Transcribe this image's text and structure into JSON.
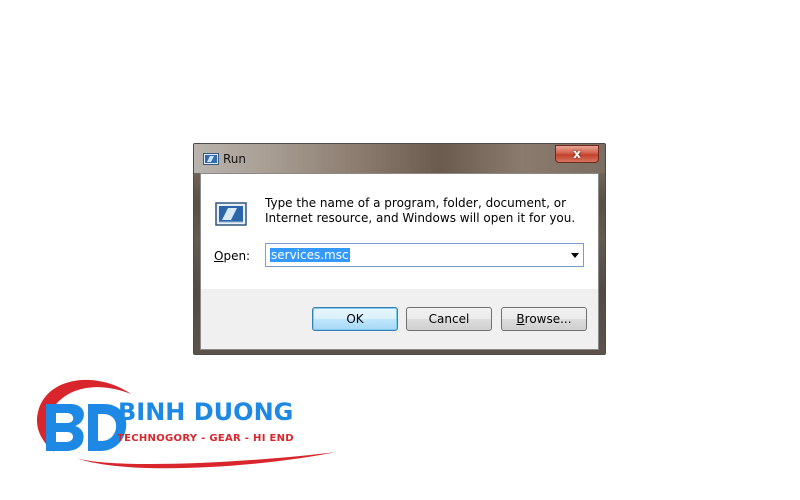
{
  "window": {
    "title": "Run",
    "close_glyph": "x"
  },
  "dialog": {
    "description": "Type the name of a program, folder, document, or Internet resource, and Windows will open it for you.",
    "open_label_accel": "O",
    "open_label_rest": "pen:",
    "open_value": "services.msc"
  },
  "buttons": {
    "ok": "OK",
    "cancel": "Cancel",
    "browse_accel": "B",
    "browse_rest": "rowse..."
  },
  "logo": {
    "name": "BINH DUONG",
    "tagline": "TECHNOGORY - GEAR - HI END",
    "colors": {
      "blue": "#1e88e5",
      "red": "#d9262c"
    }
  },
  "icons": [
    "run-icon",
    "close-icon",
    "dropdown-arrow-icon"
  ]
}
